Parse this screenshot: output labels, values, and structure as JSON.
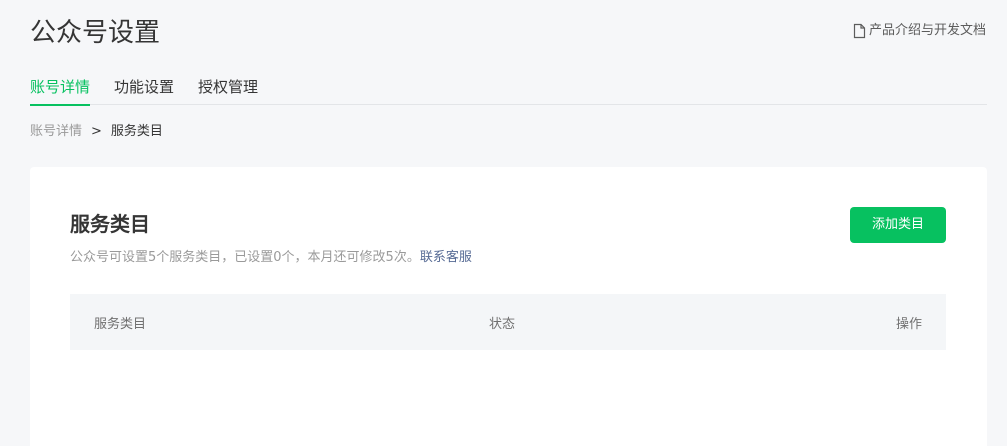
{
  "header": {
    "title": "公众号设置",
    "doc_link": "产品介绍与开发文档"
  },
  "tabs": [
    {
      "label": "账号详情",
      "active": true
    },
    {
      "label": "功能设置",
      "active": false
    },
    {
      "label": "授权管理",
      "active": false
    }
  ],
  "breadcrumb": {
    "parent": "账号详情",
    "separator": ">",
    "current": "服务类目"
  },
  "card": {
    "title": "服务类目",
    "description": "公众号可设置5个服务类目，已设置0个，本月还可修改5次。",
    "contact_link": "联系客服",
    "add_button": "添加类目",
    "table_headers": {
      "category": "服务类目",
      "status": "状态",
      "action": "操作"
    }
  },
  "colors": {
    "accent": "#07c160",
    "link": "#576b95",
    "background": "#f6f7f9"
  },
  "icons": {
    "doc": "document-icon"
  }
}
